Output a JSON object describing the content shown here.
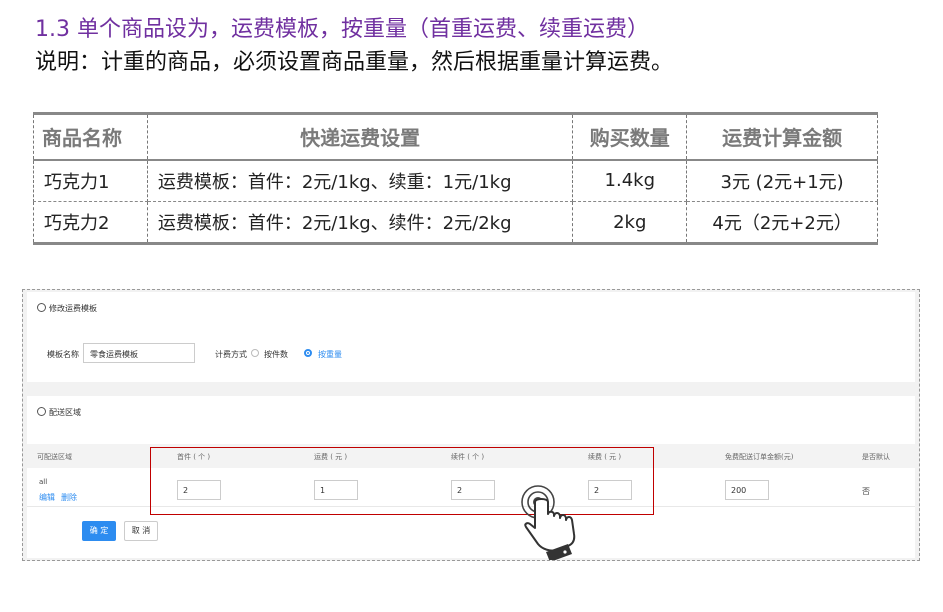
{
  "heading": "1.3 单个商品设为，运费模板，按重量（首重运费、续重运费）",
  "description": "说明：计重的商品，必须设置商品重量，然后根据重量计算运费。",
  "summary_table": {
    "headers": [
      "商品名称",
      "快递运费设置",
      "购买数量",
      "运费计算金额"
    ],
    "rows": [
      [
        "巧克力1",
        "运费模板：首件：2元/1kg、续重：1元/1kg",
        "1.4kg",
        "3元 (2元+1元)"
      ],
      [
        "巧克力2",
        "运费模板：首件：2元/1kg、续件：2元/2kg",
        "2kg",
        "4元（2元+2元）"
      ]
    ]
  },
  "screenshot": {
    "edit_panel": {
      "title": "修改运费模板",
      "template_name_label": "模板名称",
      "template_name_value": "零食运费模板",
      "billing_label": "计费方式",
      "billing_options": [
        "按件数",
        "按重量"
      ],
      "billing_selected": "按重量"
    },
    "region_panel": {
      "title": "配送区域",
      "columns": [
        "可配送区域",
        "首件 ( 个 )",
        "运费 ( 元 )",
        "续件 ( 个 )",
        "续费 ( 元 )",
        "免费配送订单金额(元)",
        "是否默认"
      ],
      "row": {
        "area": "all",
        "edit_link": "编辑",
        "delete_link": "删除",
        "first_item": "2",
        "first_fee": "1",
        "extra_item": "2",
        "extra_fee": "2",
        "free_amount": "200",
        "is_default": "否"
      },
      "confirm_button": "确 定",
      "cancel_button": "取 消"
    },
    "highlight_color": "#c00000",
    "accent_color": "#2d8cf0"
  }
}
